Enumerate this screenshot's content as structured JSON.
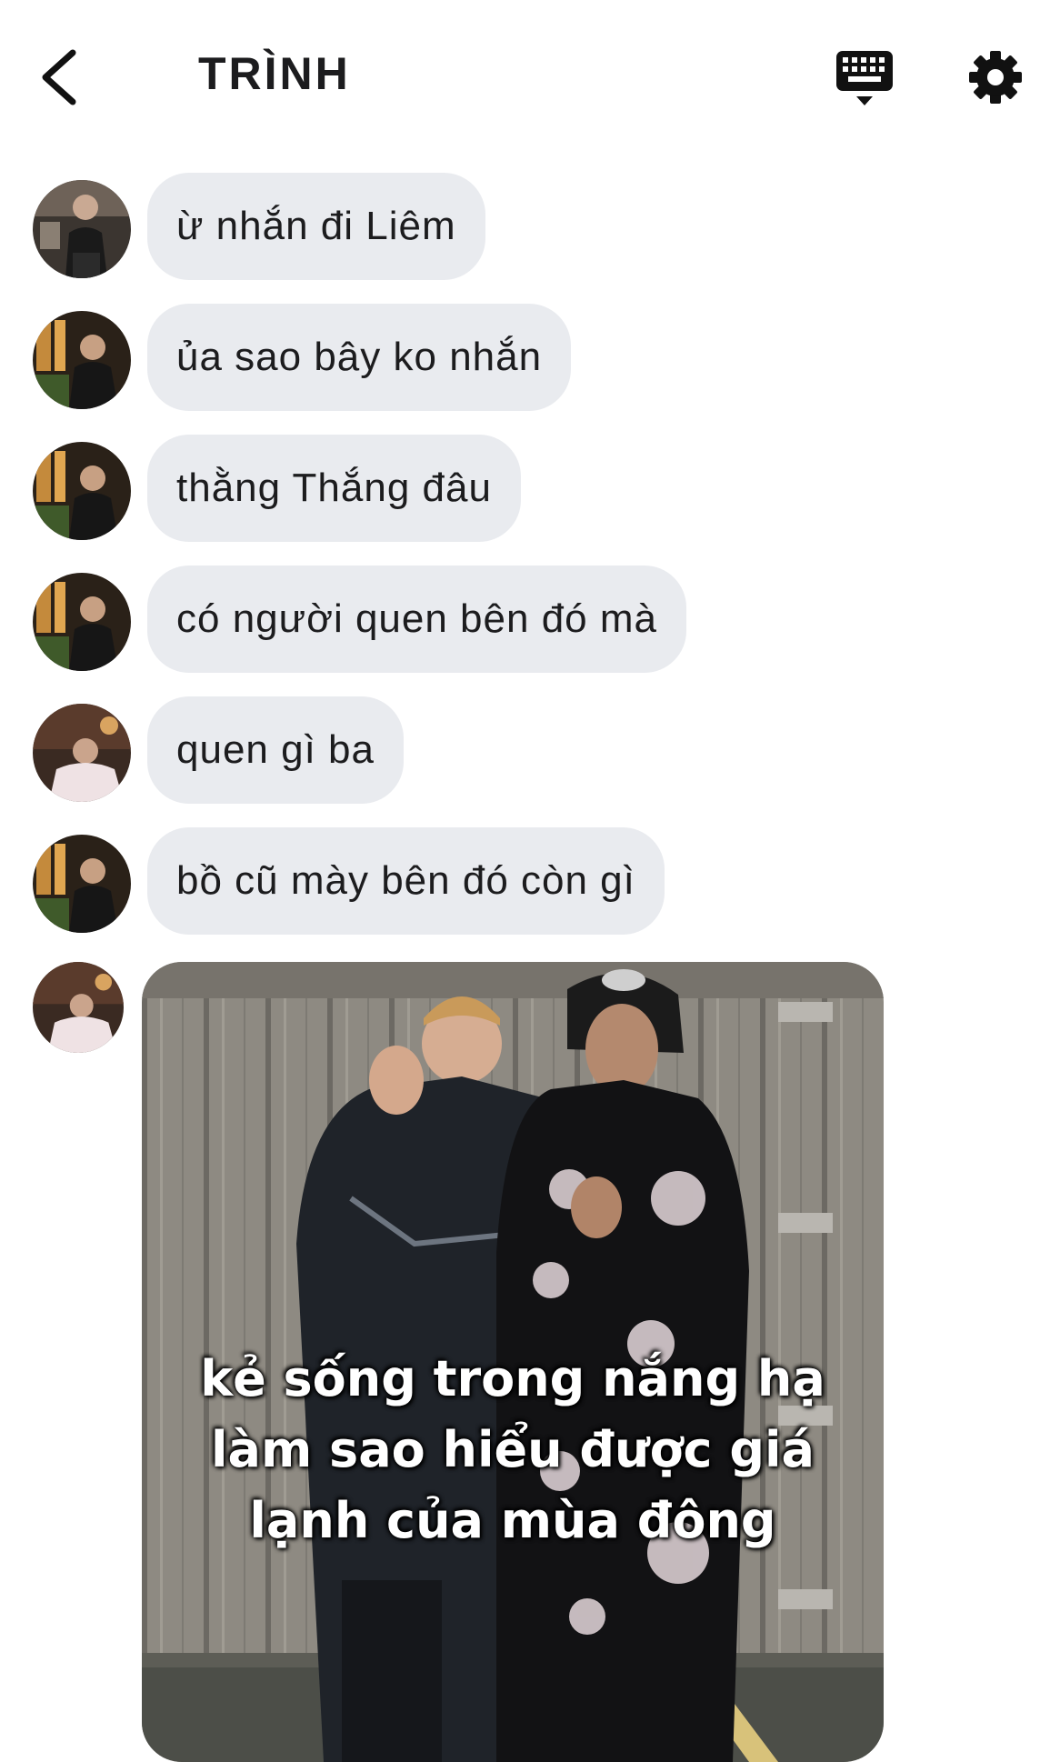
{
  "header": {
    "title": "TRÌNH",
    "back_icon": "chevron-left-icon",
    "keyboard_icon": "keyboard-icon",
    "settings_icon": "gear-icon"
  },
  "messages": [
    {
      "text": "ừ nhắn đi Liêm",
      "avatar": "avatar-a"
    },
    {
      "text": "ủa sao bây ko nhắn",
      "avatar": "avatar-b"
    },
    {
      "text": "thằng Thắng đâu",
      "avatar": "avatar-b"
    },
    {
      "text": "có người quen bên đó mà",
      "avatar": "avatar-b"
    },
    {
      "text": "quen gì ba",
      "avatar": "avatar-c"
    },
    {
      "text": "bồ cũ mày bên đó còn gì",
      "avatar": "avatar-b"
    }
  ],
  "media_message": {
    "avatar": "avatar-c",
    "caption": [
      "kẻ sống trong nắng hạ",
      "làm sao hiểu được giá",
      "lạnh của mùa đông"
    ]
  },
  "colors": {
    "bubble_bg": "#e9ebef",
    "text": "#1c1c1e",
    "background": "#ffffff"
  }
}
